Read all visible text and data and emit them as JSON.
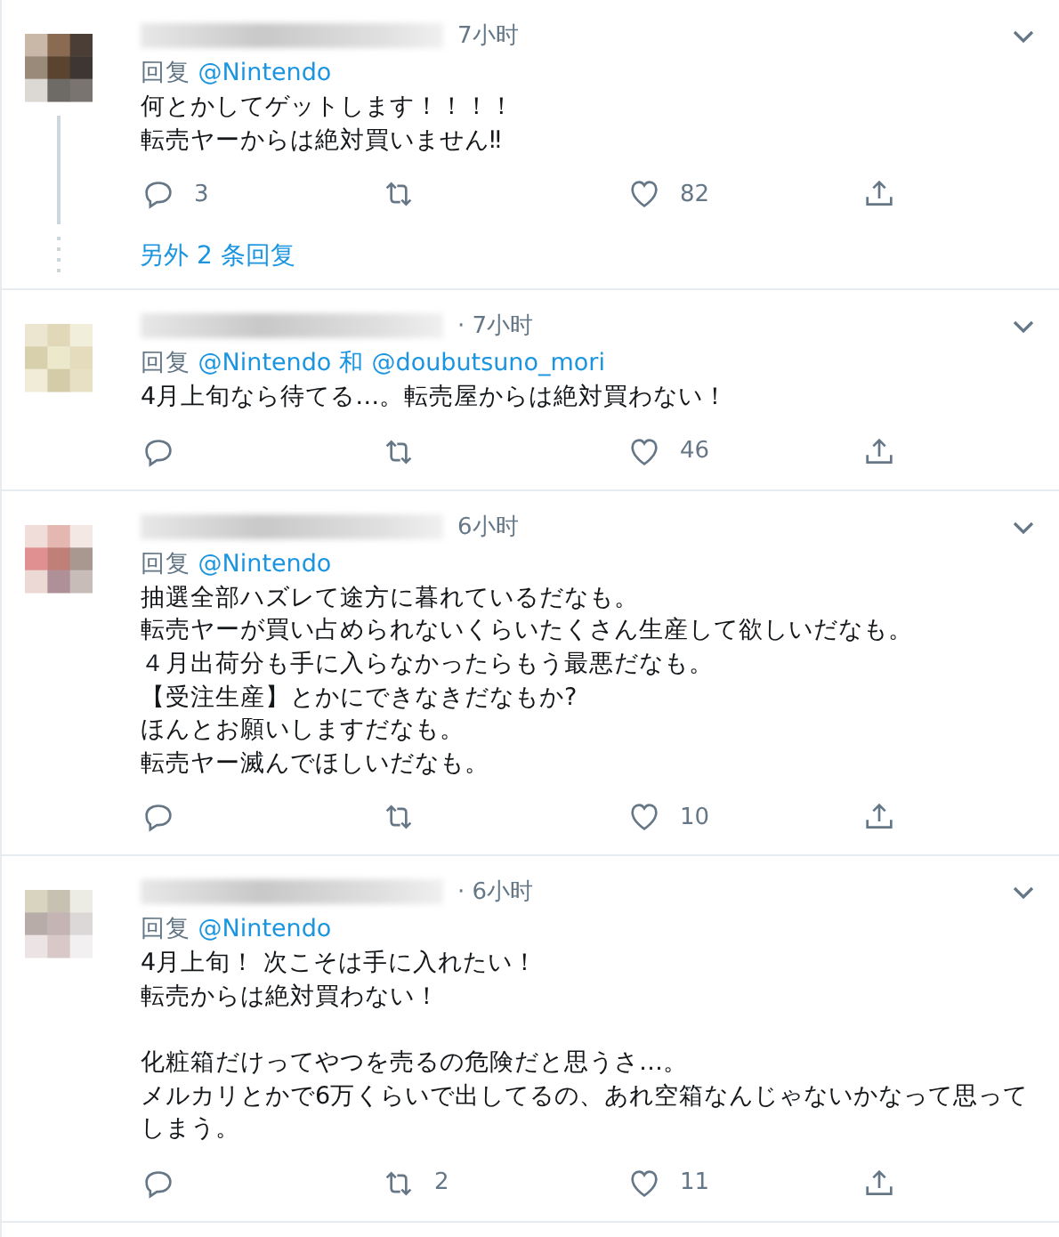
{
  "tweets": [
    {
      "time": "7小时",
      "reply_label": "回复",
      "reply_to": [
        "@Nintendo"
      ],
      "lines": [
        "何とかしてゲットします！！！！",
        "転売ヤーからは絶対買いません‼"
      ],
      "actions": [
        {
          "kind": "reply",
          "count": "3"
        },
        {
          "kind": "retweet"
        },
        {
          "kind": "like",
          "count": "82"
        },
        {
          "kind": "share"
        }
      ],
      "thread": true,
      "more_replies": "另外 2 条回复"
    },
    {
      "time": "· 7小时",
      "reply_label": "回复",
      "reply_to": [
        "@Nintendo",
        "@doubutsuno_mori"
      ],
      "joiner": "和",
      "lines": [
        "4月上旬なら待てる…。転売屋からは絶対買わない！"
      ],
      "actions": [
        {
          "kind": "reply"
        },
        {
          "kind": "retweet"
        },
        {
          "kind": "like",
          "count": "46"
        },
        {
          "kind": "share"
        }
      ],
      "thread": false
    },
    {
      "time": "6小时",
      "reply_label": "回复",
      "reply_to": [
        "@Nintendo"
      ],
      "lines": [
        "抽選全部ハズレて途方に暮れているだなも。",
        "転売ヤーが買い占められないくらいたくさん生産して欲しいだなも。",
        "４月出荷分も手に入らなかったらもう最悪だなも。",
        "【受注生産】とかにできなきだなもか?",
        "ほんとお願いしますだなも。",
        "転売ヤー滅んでほしいだなも。"
      ],
      "actions": [
        {
          "kind": "reply"
        },
        {
          "kind": "retweet"
        },
        {
          "kind": "like",
          "count": "10"
        },
        {
          "kind": "share"
        }
      ],
      "thread": false
    },
    {
      "time": "· 6小时",
      "reply_label": "回复",
      "reply_to": [
        "@Nintendo"
      ],
      "lines": [
        "4月上旬！ 次こそは手に入れたい！",
        "転売からは絶対買わない！"
      ],
      "lines_2": [
        "化粧箱だけってやつを売るの危険だと思うさ…。",
        "メルカリとかで6万くらいで出してるの、あれ空箱なんじゃないかなって思ってしまう。"
      ],
      "actions": [
        {
          "kind": "reply"
        },
        {
          "kind": "retweet",
          "count": "2"
        },
        {
          "kind": "like",
          "count": "11"
        },
        {
          "kind": "share"
        }
      ],
      "thread": false
    }
  ]
}
